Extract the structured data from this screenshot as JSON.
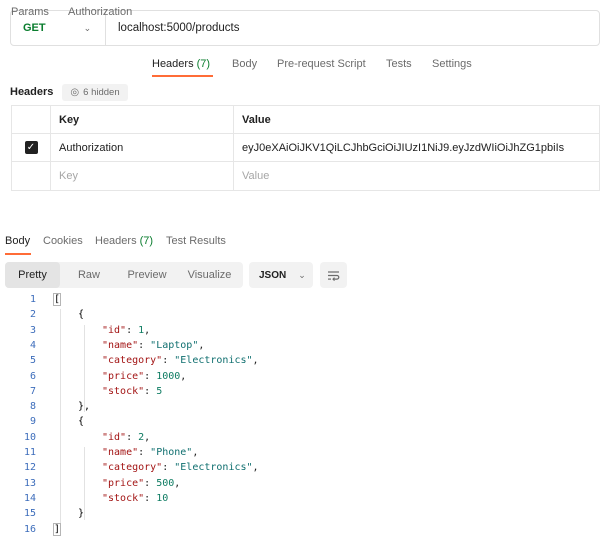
{
  "request": {
    "method": "GET",
    "url": "localhost:5000/products"
  },
  "request_tabs": [
    {
      "label": "Params",
      "count": ""
    },
    {
      "label": "Authorization",
      "count": ""
    },
    {
      "label": "Headers",
      "count": "(7)"
    },
    {
      "label": "Body",
      "count": ""
    },
    {
      "label": "Pre-request Script",
      "count": ""
    },
    {
      "label": "Tests",
      "count": ""
    },
    {
      "label": "Settings",
      "count": ""
    }
  ],
  "headers_section": {
    "title": "Headers",
    "hidden_label": "6 hidden",
    "columns": {
      "key": "Key",
      "value": "Value"
    },
    "rows": [
      {
        "checked": true,
        "key": "Authorization",
        "value": "eyJ0eXAiOiJKV1QiLCJhbGciOiJIUzI1NiJ9.eyJzdWIiOiJhZG1pbiIs"
      }
    ],
    "new_row": {
      "key_placeholder": "Key",
      "value_placeholder": "Value"
    }
  },
  "response_tabs": [
    {
      "label": "Body",
      "count": ""
    },
    {
      "label": "Cookies",
      "count": ""
    },
    {
      "label": "Headers",
      "count": "(7)"
    },
    {
      "label": "Test Results",
      "count": ""
    }
  ],
  "response_toolbar": {
    "formats": [
      "Pretty",
      "Raw",
      "Preview",
      "Visualize"
    ],
    "active_format": "Pretty",
    "language": "JSON"
  },
  "response_body": [
    {
      "n": "1",
      "indent": 0,
      "text": "["
    },
    {
      "n": "2",
      "indent": 1,
      "text": "{"
    },
    {
      "n": "3",
      "indent": 2,
      "key": "\"id\"",
      "value": "1",
      "type": "num",
      "comma": true
    },
    {
      "n": "4",
      "indent": 2,
      "key": "\"name\"",
      "value": "\"Laptop\"",
      "type": "str",
      "comma": true
    },
    {
      "n": "5",
      "indent": 2,
      "key": "\"category\"",
      "value": "\"Electronics\"",
      "type": "str",
      "comma": true
    },
    {
      "n": "6",
      "indent": 2,
      "key": "\"price\"",
      "value": "1000",
      "type": "num",
      "comma": true
    },
    {
      "n": "7",
      "indent": 2,
      "key": "\"stock\"",
      "value": "5",
      "type": "num",
      "comma": false
    },
    {
      "n": "8",
      "indent": 1,
      "text": "},"
    },
    {
      "n": "9",
      "indent": 1,
      "text": "{"
    },
    {
      "n": "10",
      "indent": 2,
      "key": "\"id\"",
      "value": "2",
      "type": "num",
      "comma": true
    },
    {
      "n": "11",
      "indent": 2,
      "key": "\"name\"",
      "value": "\"Phone\"",
      "type": "str",
      "comma": true
    },
    {
      "n": "12",
      "indent": 2,
      "key": "\"category\"",
      "value": "\"Electronics\"",
      "type": "str",
      "comma": true
    },
    {
      "n": "13",
      "indent": 2,
      "key": "\"price\"",
      "value": "500",
      "type": "num",
      "comma": true
    },
    {
      "n": "14",
      "indent": 2,
      "key": "\"stock\"",
      "value": "10",
      "type": "num",
      "comma": false
    },
    {
      "n": "15",
      "indent": 1,
      "text": "}"
    },
    {
      "n": "16",
      "indent": 0,
      "text": "]"
    }
  ],
  "colors": {
    "accent": "#ff6c37",
    "method_get": "#0a7d2e",
    "line_numbers": "#3d6dbb"
  }
}
